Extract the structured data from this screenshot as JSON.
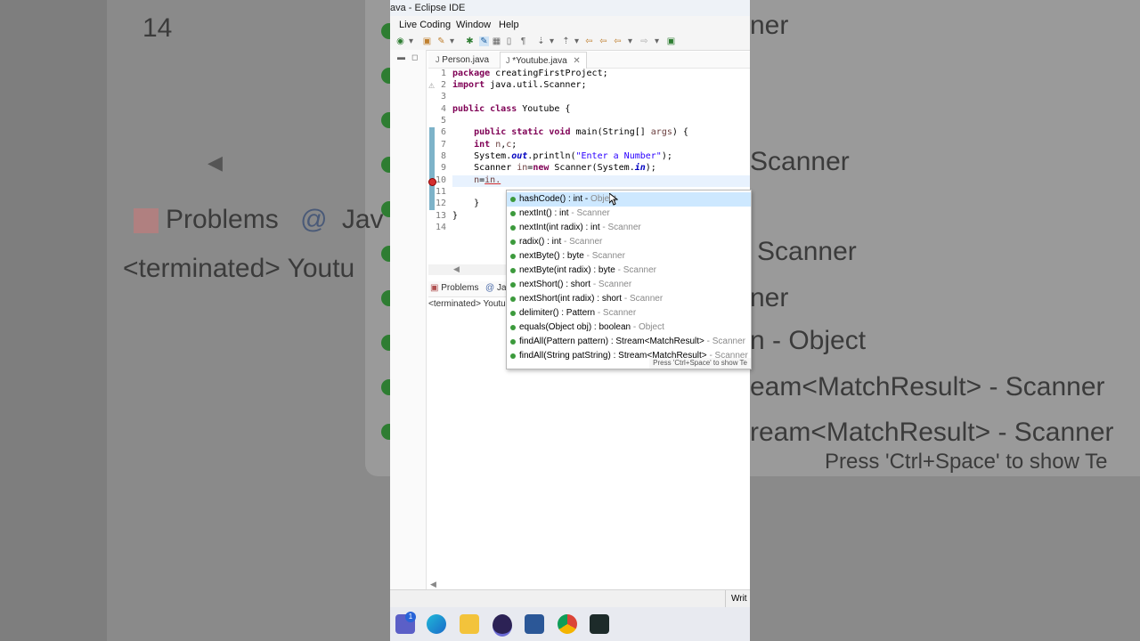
{
  "window": {
    "title": "ava - Eclipse IDE"
  },
  "menu": [
    "Live Coding",
    "Window",
    "Help"
  ],
  "tabs": [
    {
      "label": "Person.java"
    },
    {
      "label": "*Youtube.java"
    }
  ],
  "editor": {
    "lines": [
      {
        "n": "1",
        "text": "package creatingFirstProject;"
      },
      {
        "n": "2",
        "text": "import java.util.Scanner;"
      },
      {
        "n": "3",
        "text": ""
      },
      {
        "n": "4",
        "text": "public class Youtube {"
      },
      {
        "n": "5",
        "text": ""
      },
      {
        "n": "6",
        "text": "public static void main(String[] args) {"
      },
      {
        "n": "7",
        "text": "int n,c;"
      },
      {
        "n": "8",
        "text": "System.out.println(\"Enter a Number\");"
      },
      {
        "n": "9",
        "text": "Scanner in=new Scanner(System.in);"
      },
      {
        "n": "10",
        "text": "n=in."
      },
      {
        "n": "11",
        "text": ""
      },
      {
        "n": "12",
        "text": "}"
      },
      {
        "n": "13",
        "text": "}"
      },
      {
        "n": "14",
        "text": ""
      }
    ]
  },
  "bottom_panel": {
    "tabs": [
      "Problems",
      "Jav"
    ],
    "console": "<terminated> Youtu"
  },
  "autocomplete": {
    "items": [
      {
        "sig": "hashCode() : int",
        "owner": "Object"
      },
      {
        "sig": "nextInt() : int",
        "owner": "Scanner"
      },
      {
        "sig": "nextInt(int radix) : int",
        "owner": "Scanner"
      },
      {
        "sig": "radix() : int",
        "owner": "Scanner"
      },
      {
        "sig": "nextByte() : byte",
        "owner": "Scanner"
      },
      {
        "sig": "nextByte(int radix) : byte",
        "owner": "Scanner"
      },
      {
        "sig": "nextShort() : short",
        "owner": "Scanner"
      },
      {
        "sig": "nextShort(int radix) : short",
        "owner": "Scanner"
      },
      {
        "sig": "delimiter() : Pattern",
        "owner": "Scanner"
      },
      {
        "sig": "equals(Object obj) : boolean",
        "owner": "Object"
      },
      {
        "sig": "findAll(Pattern pattern) : Stream<MatchResult>",
        "owner": "Scanner"
      },
      {
        "sig": "findAll(String patString) : Stream<MatchResult>",
        "owner": "Scanner"
      }
    ],
    "hint": "Press 'Ctrl+Space' to show Te"
  },
  "status": {
    "mode": "Writ"
  },
  "background": {
    "lines": [
      "14",
      "Problems",
      "<terminated> Youtu",
      "Jav"
    ],
    "right": [
      "ner",
      "Scanner",
      "Scanner",
      "ner",
      "n - Object",
      "eam<MatchResult> - Scanner",
      "ream<MatchResult> - Scanner",
      "Press 'Ctrl+Space' to show Te"
    ]
  },
  "taskbar": {
    "badge": "1"
  }
}
